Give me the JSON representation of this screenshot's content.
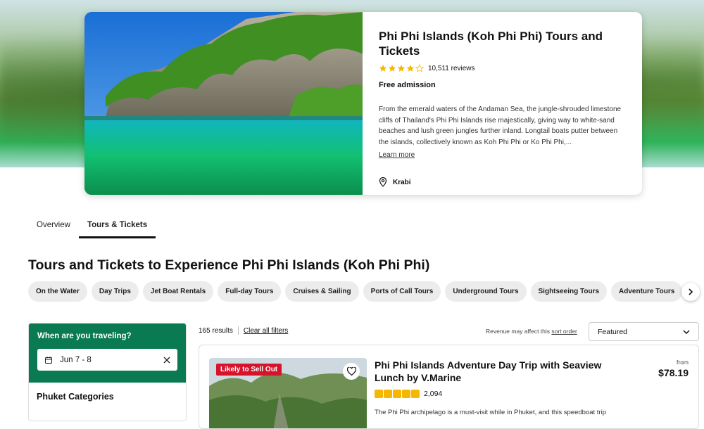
{
  "hero": {
    "title": "Phi Phi Islands (Koh Phi Phi) Tours and Tickets",
    "reviews": "10,511 reviews",
    "rating_stars": 4.5,
    "admission": "Free admission",
    "description": "From the emerald waters of the Andaman Sea, the jungle-shrouded limestone cliffs of Thailand's Phi Phi Islands rise majestically, giving way to white-sand beaches and lush green jungles further inland. Longtail boats putter between the islands, collectively known as Koh Phi Phi or Ko Phi Phi,...",
    "learn_more": "Learn more",
    "location": "Krabi"
  },
  "tabs": [
    {
      "label": "Overview"
    },
    {
      "label": "Tours & Tickets"
    }
  ],
  "section_title": "Tours and Tickets to Experience Phi Phi Islands (Koh Phi Phi)",
  "chips": [
    "On the Water",
    "Day Trips",
    "Jet Boat Rentals",
    "Full-day Tours",
    "Cruises & Sailing",
    "Ports of Call Tours",
    "Underground Tours",
    "Sightseeing Tours",
    "Adventure Tours"
  ],
  "filter": {
    "question": "When are you traveling?",
    "date": "Jun 7 - 8",
    "category_title": "Phuket Categories"
  },
  "results": {
    "count": "165 results",
    "clear": "Clear all filters",
    "revenue_note": "Revenue may affect this",
    "sort_link": "sort order",
    "sort_value": "Featured"
  },
  "product": {
    "badge": "Likely to Sell Out",
    "title": "Phi Phi Islands Adventure Day Trip with Seaview Lunch by V.Marine",
    "rating_count": "2,094",
    "description": "The Phi Phi archipelago is a must-visit while in Phuket, and this speedboat trip",
    "from": "from",
    "price": "$78.19"
  },
  "colors": {
    "brand_green": "#0a7a53",
    "badge_red": "#d5142b",
    "star_yellow": "#f5b700"
  }
}
